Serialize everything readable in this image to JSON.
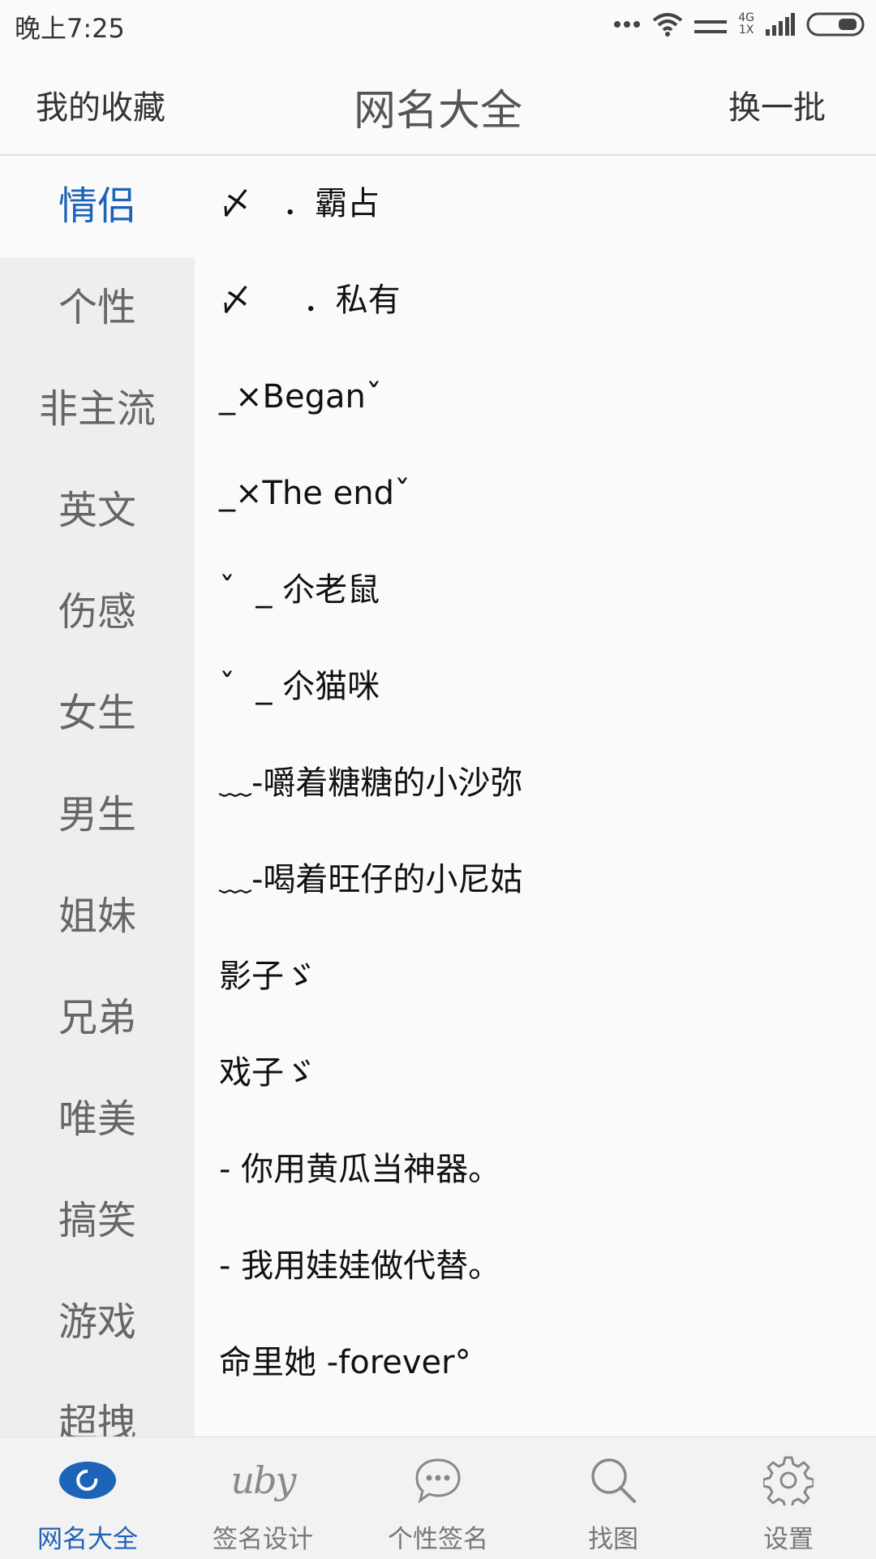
{
  "status": {
    "time": "晚上7:25",
    "network_top": "4G",
    "network_bottom": "1X"
  },
  "header": {
    "left": "我的收藏",
    "title": "网名大全",
    "right": "换一批"
  },
  "sidebar": {
    "items": [
      {
        "label": "情侣"
      },
      {
        "label": "个性"
      },
      {
        "label": "非主流"
      },
      {
        "label": "英文"
      },
      {
        "label": "伤感"
      },
      {
        "label": "女生"
      },
      {
        "label": "男生"
      },
      {
        "label": "姐妹"
      },
      {
        "label": "兄弟"
      },
      {
        "label": "唯美"
      },
      {
        "label": "搞笑"
      },
      {
        "label": "游戏"
      },
      {
        "label": "超拽"
      }
    ]
  },
  "list": {
    "items": [
      {
        "text": "〆   ．霸占"
      },
      {
        "text": "〆     ．私有"
      },
      {
        "text": "_×Beganˇ"
      },
      {
        "text": "_×The endˇ"
      },
      {
        "text": "ˇ  _ 尒老鼠"
      },
      {
        "text": "ˇ  _ 尒猫咪"
      },
      {
        "text": "﹏-嚼着糖糖的小沙弥"
      },
      {
        "text": "﹏-喝着旺仔的小尼姑"
      },
      {
        "text": "影子ゞ"
      },
      {
        "text": "戏子ゞ"
      },
      {
        "text": "- 你用黄瓜当神器。"
      },
      {
        "text": "- 我用娃娃做代替。"
      },
      {
        "text": "命里她 -forever°"
      }
    ]
  },
  "bottom_nav": {
    "items": [
      {
        "label": "网名大全",
        "icon": "eye-icon"
      },
      {
        "label": "签名设计",
        "icon": "signature-icon",
        "glyph": "uby"
      },
      {
        "label": "个性签名",
        "icon": "chat-bubble-icon"
      },
      {
        "label": "找图",
        "icon": "search-icon"
      },
      {
        "label": "设置",
        "icon": "gear-icon"
      }
    ]
  },
  "colors": {
    "accent": "#1d63b8",
    "sidebar_bg": "#eeeeee",
    "page_bg": "#fafafa",
    "muted": "#777777"
  }
}
